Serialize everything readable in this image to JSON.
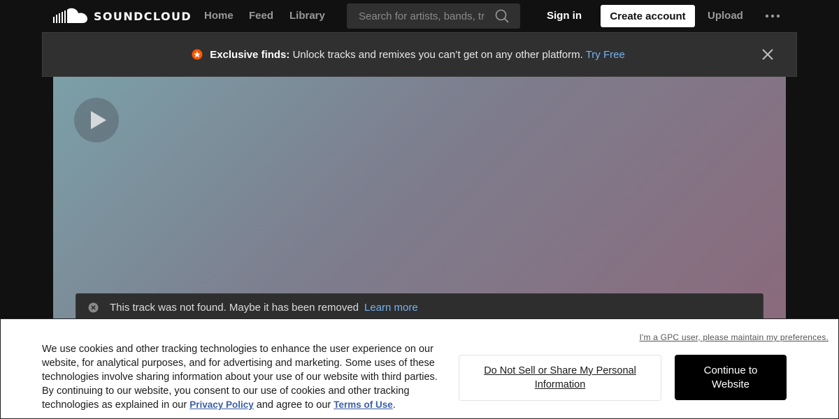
{
  "header": {
    "logo_text": "SOUNDCLOUD",
    "nav": [
      "Home",
      "Feed",
      "Library"
    ],
    "search_placeholder": "Search for artists, bands, tr",
    "sign_in": "Sign in",
    "create_account": "Create account",
    "upload": "Upload",
    "more_icon": "more-horizontal-icon"
  },
  "banner": {
    "icon": "star-badge-icon",
    "strong": "Exclusive finds:",
    "text": "Unlock tracks and remixes you can’t get on any other platform.",
    "link": "Try Free",
    "close_icon": "close-icon"
  },
  "hero": {
    "play_icon": "play-icon",
    "not_found": "This track was not found. Maybe it has been removed",
    "learn_more": "Learn more",
    "colors": {
      "gradient_start": "#7ba0a8",
      "gradient_end": "#8a6a7c"
    }
  },
  "cookie": {
    "gpc": "I'm a GPC user, please maintain my preferences.",
    "text": "We use cookies and other tracking technologies to enhance the user experience on our website, for analytical purposes, and for advertising and marketing. Some uses of these technologies involve sharing information about your use of our website with third parties. By continuing to our website, you consent to our use of cookies and other tracking technologies as explained in our",
    "privacy_link": "Privacy Policy",
    "and_text": "and agree to our",
    "terms_link": "Terms of Use",
    "period": ".",
    "dns_button": "Do Not Sell or Share My Personal Information",
    "continue_button": "Continue to Website"
  },
  "colors": {
    "accent": "#ff5500",
    "link": "#73b3f2",
    "background": "#111111"
  }
}
